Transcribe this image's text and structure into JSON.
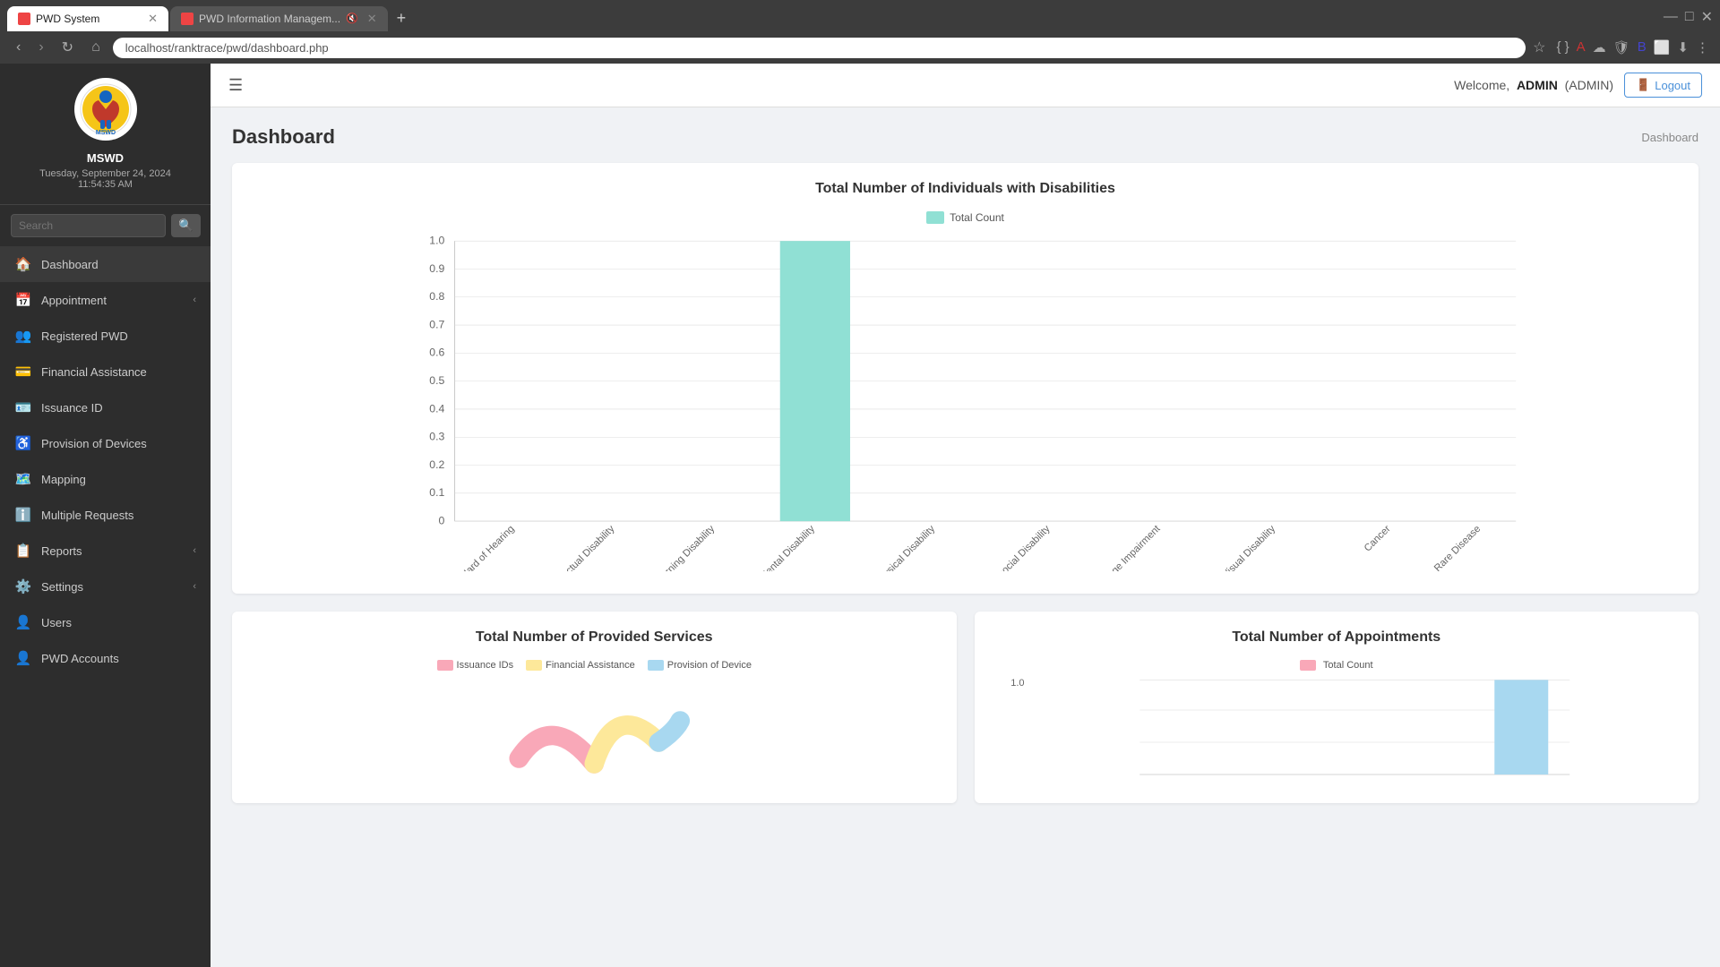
{
  "browser": {
    "tabs": [
      {
        "id": "tab1",
        "label": "PWD System",
        "active": true,
        "favicon": "PWD"
      },
      {
        "id": "tab2",
        "label": "PWD Information Managem...",
        "active": false,
        "favicon": "PWD"
      }
    ],
    "url": "localhost/ranktrace/pwd/dashboard.php",
    "window_controls": {
      "minimize": "—",
      "maximize": "□",
      "close": "✕"
    }
  },
  "sidebar": {
    "logo_alt": "MSWD Logo",
    "logo_text": "MSWD",
    "date": "Tuesday, September 24, 2024",
    "time": "11:54:35 AM",
    "search_placeholder": "Search",
    "nav_items": [
      {
        "id": "dashboard",
        "label": "Dashboard",
        "icon": "🏠",
        "has_arrow": false
      },
      {
        "id": "appointment",
        "label": "Appointment",
        "icon": "📅",
        "has_arrow": true
      },
      {
        "id": "registered-pwd",
        "label": "Registered PWD",
        "icon": "👥",
        "has_arrow": false
      },
      {
        "id": "financial-assistance",
        "label": "Financial Assistance",
        "icon": "💳",
        "has_arrow": false
      },
      {
        "id": "issuance-id",
        "label": "Issuance ID",
        "icon": "🪪",
        "has_arrow": false
      },
      {
        "id": "provision-of-devices",
        "label": "Provision of Devices",
        "icon": "♿",
        "has_arrow": false
      },
      {
        "id": "mapping",
        "label": "Mapping",
        "icon": "🗺️",
        "has_arrow": false
      },
      {
        "id": "multiple-requests",
        "label": "Multiple Requests",
        "icon": "ℹ️",
        "has_arrow": false
      },
      {
        "id": "reports",
        "label": "Reports",
        "icon": "📋",
        "has_arrow": true
      },
      {
        "id": "settings",
        "label": "Settings",
        "icon": "⚙️",
        "has_arrow": true
      },
      {
        "id": "users",
        "label": "Users",
        "icon": "👤",
        "has_arrow": false
      },
      {
        "id": "pwd-accounts",
        "label": "PWD Accounts",
        "icon": "👤",
        "has_arrow": false
      }
    ]
  },
  "topbar": {
    "welcome_prefix": "Welcome,",
    "username": "ADMIN",
    "role": "(ADMIN)",
    "logout_label": "Logout"
  },
  "page": {
    "title": "Dashboard",
    "breadcrumb": "Dashboard"
  },
  "bar_chart": {
    "title": "Total Number of Individuals with Disabilities",
    "legend_label": "Total Count",
    "legend_color": "#90e0d4",
    "categories": [
      "Deaf or Hard of Hearing",
      "Intellectual Disability",
      "Learning Disability",
      "Mental Disability",
      "Physical Disability",
      "Psychosocial Disability",
      "Speech and Language Impairment",
      "Visual Disability",
      "Cancer",
      "Rare Disease"
    ],
    "values": [
      0,
      0,
      0,
      1.0,
      0,
      0,
      0,
      0,
      0,
      0
    ],
    "y_labels": [
      "0",
      "0.1",
      "0.2",
      "0.3",
      "0.4",
      "0.5",
      "0.6",
      "0.7",
      "0.8",
      "0.9",
      "1.0"
    ]
  },
  "bottom_charts": {
    "provided_services": {
      "title": "Total Number of Provided Services",
      "legend": [
        {
          "label": "Issuance IDs",
          "color": "#f9a8b8"
        },
        {
          "label": "Financial Assistance",
          "color": "#fde89a"
        },
        {
          "label": "Provision of Device",
          "color": "#a8d8f0"
        }
      ]
    },
    "appointments": {
      "title": "Total Number of Appointments",
      "legend": [
        {
          "label": "Total Count",
          "color": "#f9a8b8"
        }
      ],
      "y_label": "1.0"
    }
  }
}
